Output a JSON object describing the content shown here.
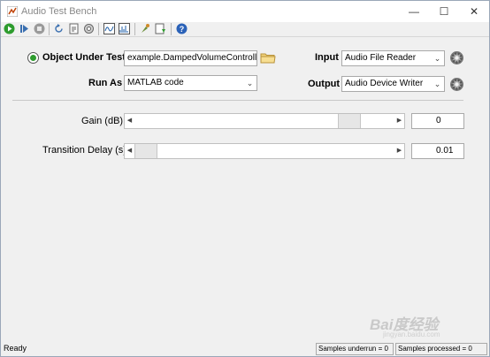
{
  "window": {
    "title": "Audio Test Bench",
    "minimize": "—",
    "maximize": "☐",
    "close": "✕"
  },
  "toolbar": {
    "icons": [
      "run-icon",
      "step-icon",
      "stop-icon",
      "reset-icon",
      "export-icon",
      "settings-icon",
      "time-scope-icon",
      "spectrum-analyzer-icon",
      "tune-icon",
      "generate-code-icon",
      "help-icon"
    ]
  },
  "object_under_test": {
    "label": "Object Under Test",
    "value": "example.DampedVolumeController"
  },
  "run_as": {
    "label": "Run As",
    "value": "MATLAB code"
  },
  "input": {
    "label": "Input",
    "value": "Audio File Reader"
  },
  "output": {
    "label": "Output",
    "value": "Audio Device Writer"
  },
  "parameters": [
    {
      "label": "Gain (dB)",
      "value": "0",
      "level": 0.857
    },
    {
      "label": "Transition Delay (s)",
      "value": "0.01",
      "level": 0.0
    }
  ],
  "status": {
    "text": "Ready",
    "underrun": "Samples underrun = 0",
    "processed": "Samples processed = 0"
  },
  "watermark": {
    "logo": "Bai度经验",
    "url": "jingyan.baidu.com"
  },
  "colors": {
    "accent_green": "#2e9c2e",
    "border": "#a9a9a9"
  }
}
